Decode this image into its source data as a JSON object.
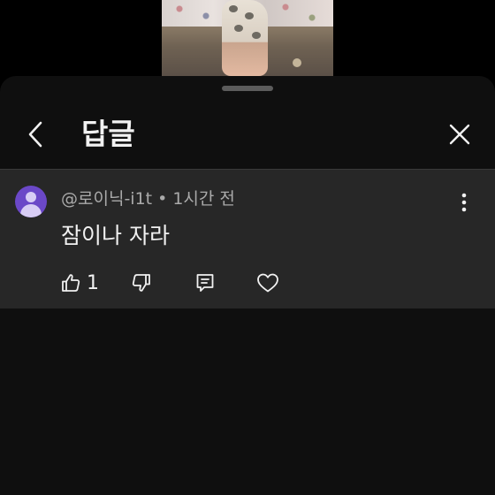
{
  "sheet": {
    "title": "답글"
  },
  "comment": {
    "author": "@로이닉-i1t",
    "separator": "•",
    "time": "1시간 전",
    "text": "잠이나 자라",
    "like_count": "1"
  },
  "colors": {
    "sheet_background": "#0f0f0f",
    "comment_background": "#272727",
    "avatar": "#6b48c8",
    "text_primary": "#f1f1f1",
    "text_secondary": "#aaaaaa"
  },
  "icons": {
    "back": "chevron-left-icon",
    "close": "close-icon",
    "more": "more-vertical-icon",
    "like": "thumbs-up-icon",
    "dislike": "thumbs-down-icon",
    "reply": "reply-comment-icon",
    "heart": "heart-icon"
  }
}
